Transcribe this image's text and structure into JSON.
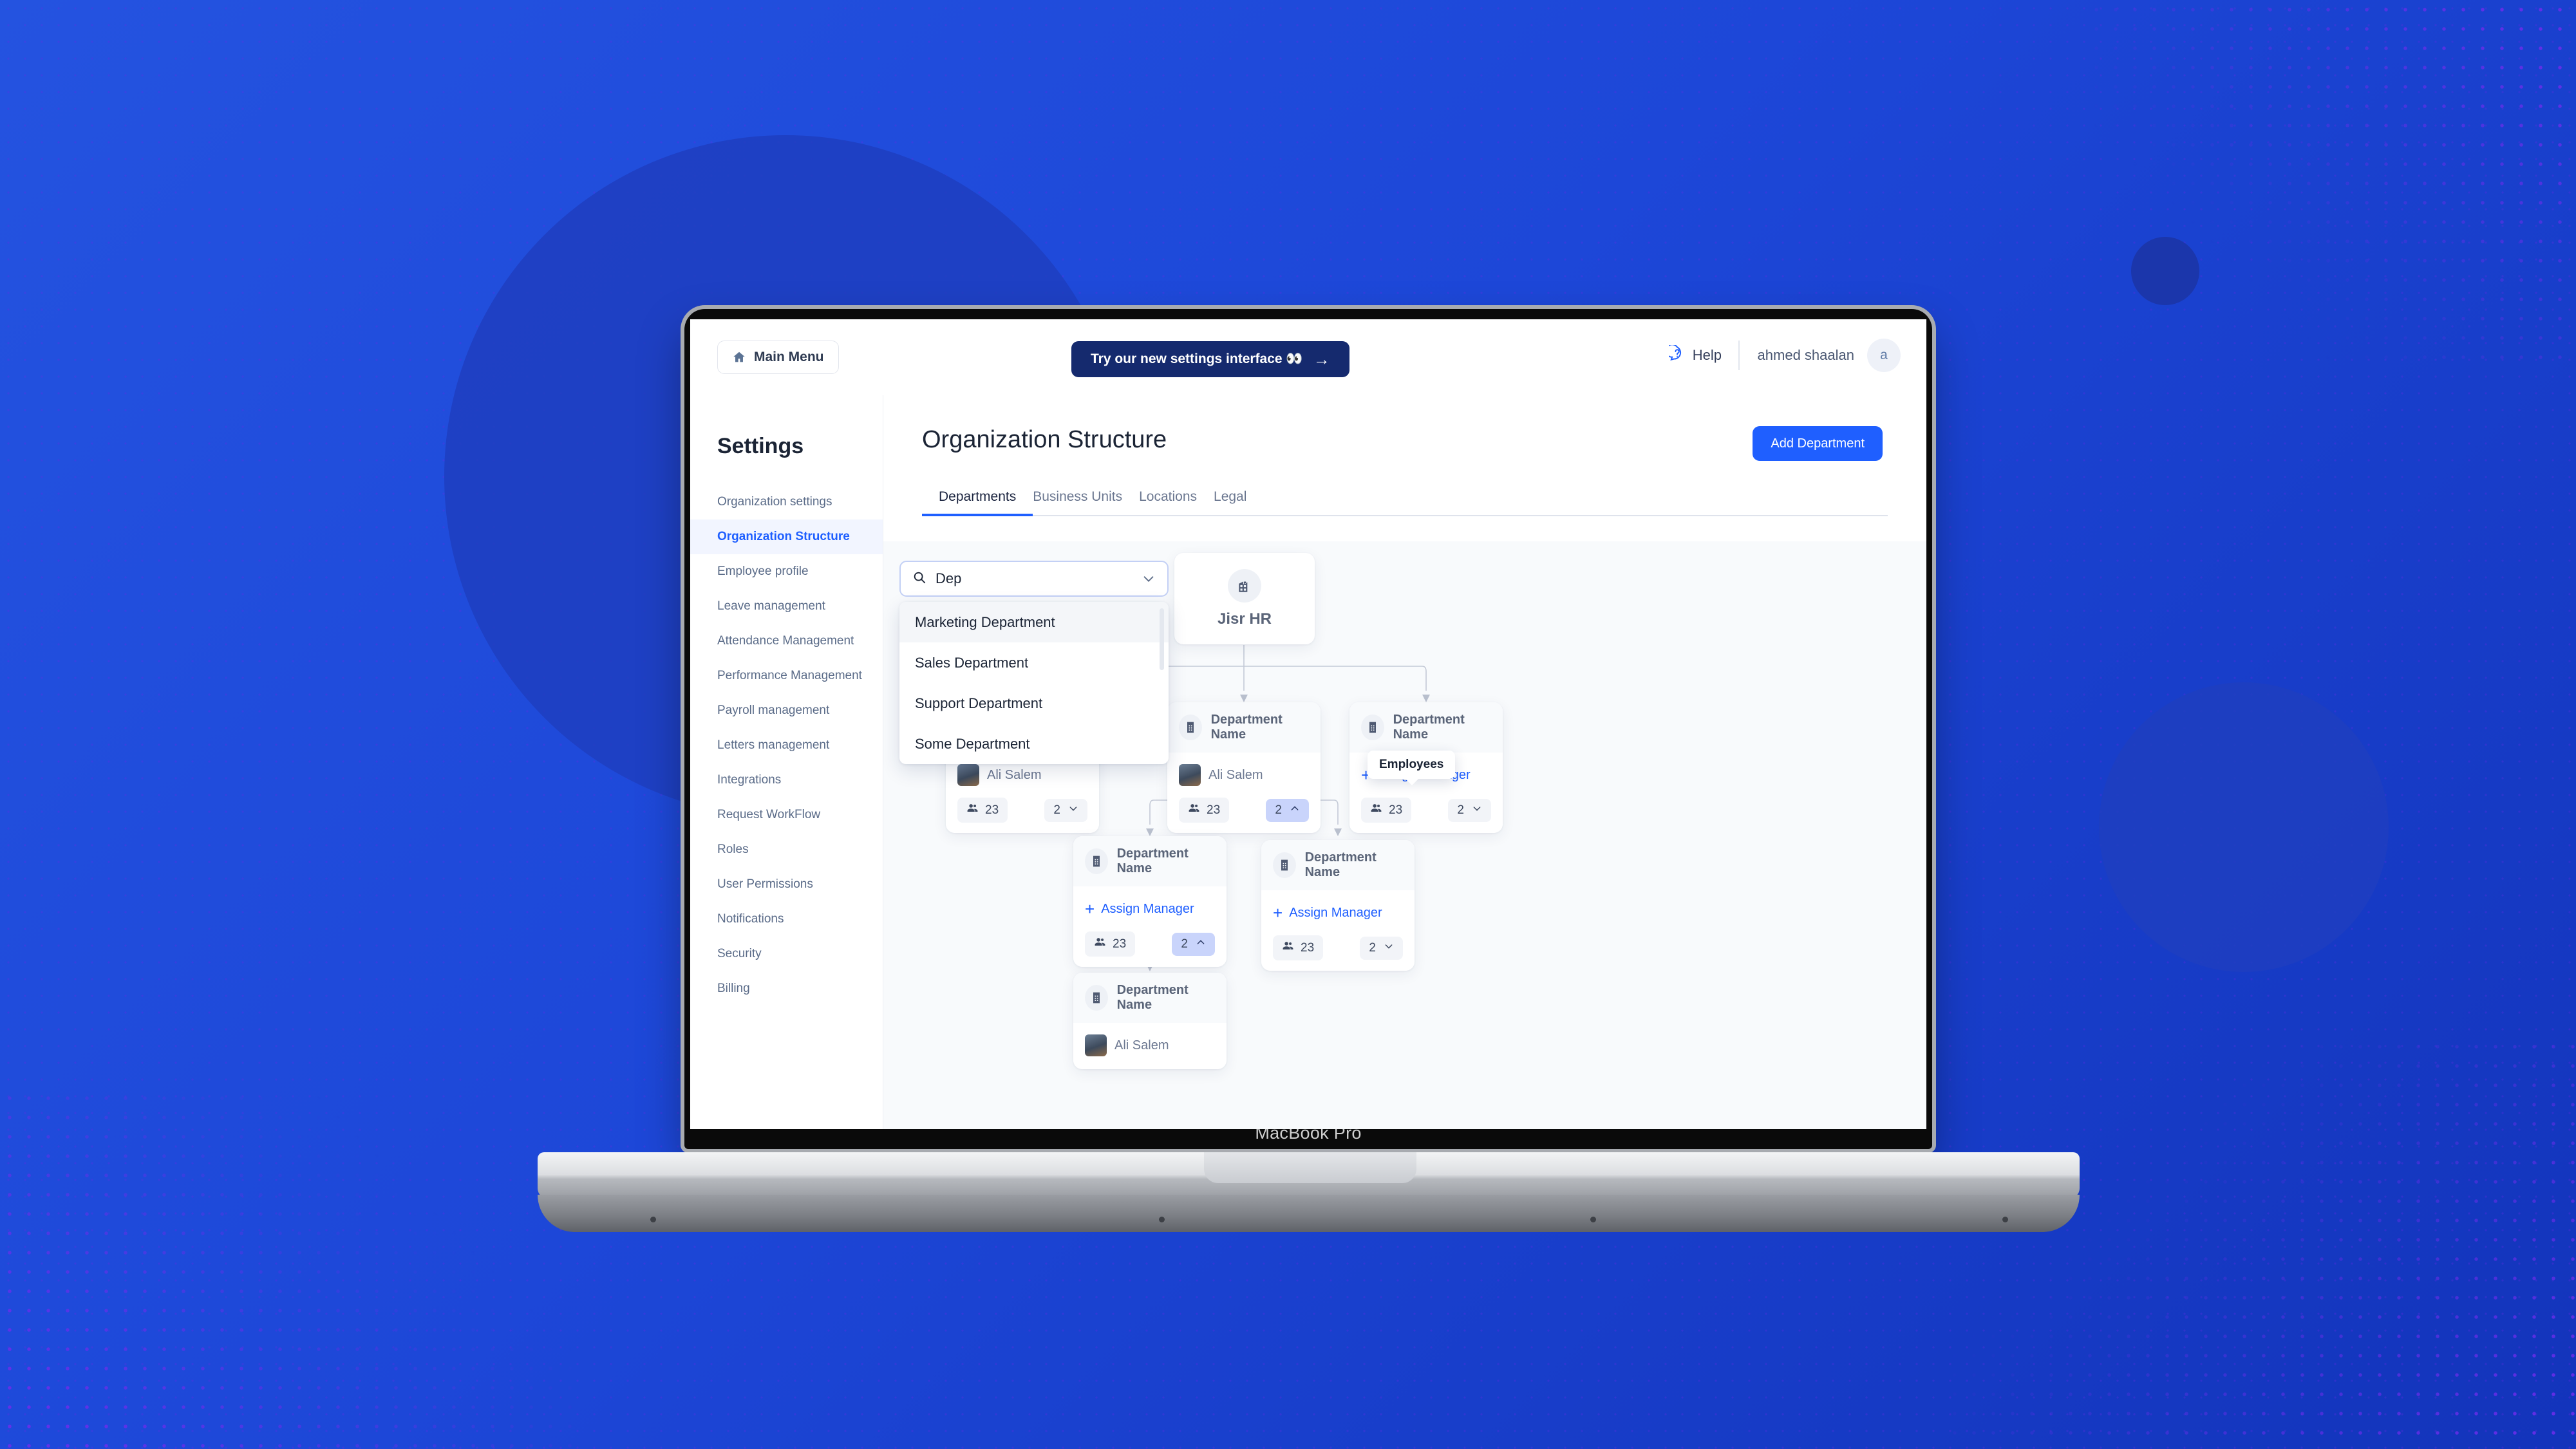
{
  "device": {
    "label": "MacBook Pro"
  },
  "topbar": {
    "main_menu_label": "Main Menu",
    "home_icon": "home-icon",
    "promo_text": "Try our new settings interface 👀",
    "promo_arrow": "→",
    "help_label": "Help",
    "help_icon": "help-question-icon",
    "user_name": "ahmed shaalan",
    "avatar_initial": "a"
  },
  "sidebar": {
    "title": "Settings",
    "items": [
      {
        "label": "Organization settings",
        "active": false
      },
      {
        "label": "Organization Structure",
        "active": true
      },
      {
        "label": "Employee profile",
        "active": false
      },
      {
        "label": "Leave management",
        "active": false
      },
      {
        "label": "Attendance Management",
        "active": false
      },
      {
        "label": "Performance Management",
        "active": false
      },
      {
        "label": "Payroll management",
        "active": false
      },
      {
        "label": "Letters management",
        "active": false
      },
      {
        "label": "Integrations",
        "active": false
      },
      {
        "label": "Request WorkFlow",
        "active": false
      },
      {
        "label": "Roles",
        "active": false
      },
      {
        "label": "User Permissions",
        "active": false
      },
      {
        "label": "Notifications",
        "active": false
      },
      {
        "label": "Security",
        "active": false
      },
      {
        "label": "Billing",
        "active": false
      }
    ]
  },
  "main": {
    "page_title": "Organization Structure",
    "add_button": "Add Department",
    "tabs": [
      {
        "label": "Departments",
        "active": true
      },
      {
        "label": "Business Units",
        "active": false
      },
      {
        "label": "Locations",
        "active": false
      },
      {
        "label": "Legal",
        "active": false
      }
    ]
  },
  "search": {
    "icon": "search-icon",
    "value": "Dep",
    "chevron_icon": "chevron-down-icon",
    "options": [
      {
        "label": "Marketing Department",
        "highlighted": true
      },
      {
        "label": "Sales Department",
        "highlighted": false
      },
      {
        "label": "Support Department",
        "highlighted": false
      },
      {
        "label": "Some Department",
        "highlighted": false
      }
    ]
  },
  "org_chart": {
    "root": {
      "label": "Jisr HR",
      "icon": "building-icon"
    },
    "tooltip": "Employees",
    "nodes": [
      {
        "id": "n1",
        "title": "Department Name",
        "icon": "building-icon",
        "manager": "Ali Salem",
        "has_manager": true,
        "employees": "23",
        "children_count": "2",
        "expanded": false
      },
      {
        "id": "n2",
        "title": "Department Name",
        "icon": "building-icon",
        "manager": "Ali Salem",
        "has_manager": true,
        "employees": "23",
        "children_count": "2",
        "expanded": true
      },
      {
        "id": "n3",
        "title": "Department Name",
        "icon": "building-icon",
        "manager": "Assign Manager",
        "has_manager": false,
        "employees": "23",
        "children_count": "2",
        "expanded": false
      },
      {
        "id": "n4",
        "title": "Department Name",
        "icon": "building-icon",
        "manager": "Assign Manager",
        "has_manager": false,
        "employees": "23",
        "children_count": "2",
        "expanded": true
      },
      {
        "id": "n5",
        "title": "Department Name",
        "icon": "building-icon",
        "manager": "Assign Manager",
        "has_manager": false,
        "employees": "23",
        "children_count": "2",
        "expanded": false
      },
      {
        "id": "n6",
        "title": "Department Name",
        "icon": "building-icon",
        "manager": "Ali Salem",
        "has_manager": true,
        "employees": "",
        "children_count": "",
        "expanded": false
      }
    ]
  },
  "colors": {
    "background_blue": "#1d47d8",
    "accent_blue": "#1f5fff",
    "promo_navy": "#152a6e",
    "toggle_active": "#c9d4fb"
  }
}
